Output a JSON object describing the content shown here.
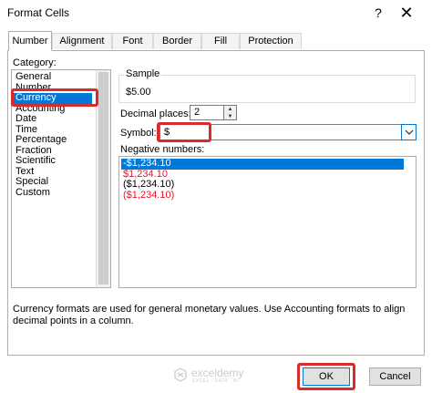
{
  "window": {
    "title": "Format Cells",
    "help_label": "?",
    "close_label": "✕"
  },
  "tabs": [
    {
      "label": "Number",
      "active": true
    },
    {
      "label": "Alignment",
      "active": false
    },
    {
      "label": "Font",
      "active": false
    },
    {
      "label": "Border",
      "active": false
    },
    {
      "label": "Fill",
      "active": false
    },
    {
      "label": "Protection",
      "active": false
    }
  ],
  "category": {
    "label": "Category:",
    "items": [
      "General",
      "Number",
      "Currency",
      "Accounting",
      "Date",
      "Time",
      "Percentage",
      "Fraction",
      "Scientific",
      "Text",
      "Special",
      "Custom"
    ],
    "selected": "Currency"
  },
  "sample": {
    "label": "Sample",
    "value": "$5.00"
  },
  "decimal_places": {
    "label": "Decimal places:",
    "value": "2"
  },
  "symbol": {
    "label": "Symbol:",
    "value": "$",
    "dropdown_icon": "chevron-down-icon"
  },
  "negative_numbers": {
    "label": "Negative numbers:",
    "items": [
      {
        "text": "-$1,234.10",
        "color": "#ffffff",
        "selected": true
      },
      {
        "text": "$1,234.10",
        "color": "#e81123",
        "selected": false
      },
      {
        "text": "($1,234.10)",
        "color": "#000000",
        "selected": false
      },
      {
        "text": "($1,234.10)",
        "color": "#e81123",
        "selected": false
      }
    ]
  },
  "description": "Currency formats are used for general monetary values.  Use Accounting formats to align decimal points in a column.",
  "watermark": {
    "name": "exceldemy",
    "tagline": "EXCEL · DATA · BI"
  },
  "buttons": {
    "ok": "OK",
    "cancel": "Cancel"
  },
  "highlight_color": "#d92b2b",
  "accent_color": "#0078d7"
}
